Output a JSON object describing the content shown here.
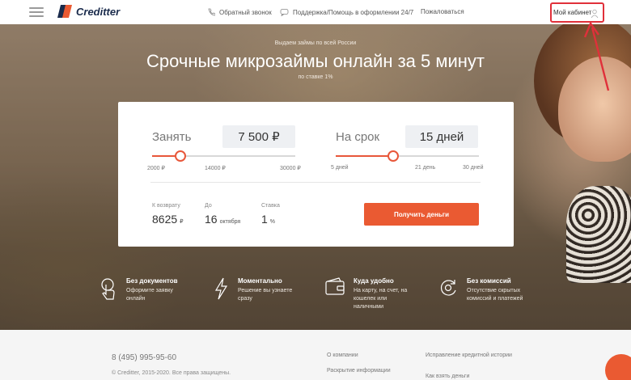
{
  "header": {
    "logo_text": "Creditter",
    "nav": {
      "callback": "Обратный звонок",
      "support": "Поддержка/Помощь в оформлении 24/7",
      "complain": "Пожаловаться"
    },
    "cabinet": "Мой кабинет"
  },
  "hero": {
    "kicker": "Выдаем займы по всей России",
    "title": "Срочные микрозаймы онлайн за 5 минут",
    "rate_note": "по ставке 1%"
  },
  "calculator": {
    "amount": {
      "label": "Занять",
      "value": "7 500 ₽",
      "min": "2000 ₽",
      "mid": "14000 ₽",
      "max": "30000 ₽",
      "level": 0.196
    },
    "term": {
      "label": "На срок",
      "value": "15 дней",
      "min": "5 дней",
      "mid": "21 день",
      "max": "30 дней",
      "level": 0.4
    },
    "summary": {
      "return_label": "К возврату",
      "return_value": "8625",
      "return_unit": "₽",
      "due_label": "До",
      "due_day": "16",
      "due_month": "октября",
      "rate_label": "Ставка",
      "rate_value": "1",
      "rate_unit": "%"
    },
    "cta": "Получить деньги"
  },
  "features": [
    {
      "icon": "touch-icon",
      "title": "Без документов",
      "text": "Оформите заявку онлайн"
    },
    {
      "icon": "lightning-icon",
      "title": "Моментально",
      "text": "Решение вы узнаете сразу"
    },
    {
      "icon": "wallet-icon",
      "title": "Куда удобно",
      "text": "На карту, на счет, на кошелек или наличными"
    },
    {
      "icon": "refresh-icon",
      "title": "Без комиссий",
      "text": "Отсутствие скрытых комиссий и платежей"
    }
  ],
  "footer": {
    "phone": "8 (495) 995-95-60",
    "copyright": "© Creditter, 2015-2020. Все права защищены.",
    "links": [
      "О компании",
      "Раскрытие информации",
      "Исправление кредитной истории",
      "Как взять деньги"
    ]
  },
  "colors": {
    "accent": "#ea5a32",
    "highlight": "#e0303a",
    "logo_dark": "#1a2b4c"
  }
}
